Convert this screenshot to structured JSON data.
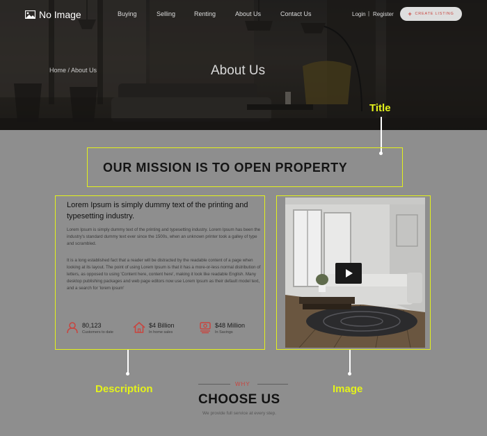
{
  "header": {
    "logo_text": "No Image",
    "nav": [
      "Buying",
      "Selling",
      "Renting",
      "About Us",
      "Contact Us"
    ],
    "login": "Login",
    "separator": "|",
    "register": "Register",
    "create_listing": "CREATE LISTING"
  },
  "hero": {
    "breadcrumb": "Home / About Us",
    "title": "About Us"
  },
  "annotations": {
    "title": "Title",
    "description": "Description",
    "image": "Image"
  },
  "mission": {
    "heading": "OUR MISSION IS TO OPEN PROPERTY",
    "lead": "Lorem Ipsum is simply dummy text of the printing and typesetting industry.",
    "paragraph1": "Lorem Ipsum is simply dummy text of the printing and typesetting industry. Lorem Ipsum has been the industry's standard dummy text ever since the 1500s, when an unknown printer took a galley of type and scrambled.",
    "paragraph2": "It is a long established fact that a reader will be distracted by the readable content of a page when looking at its layout. The point of using Lorem Ipsum is that it has a more-or-less normal distribution of letters, as opposed to using 'Content here, content here', making it look like readable English. Many desktop publishing packages and web page editors now use Lorem Ipsum as their default model text, and a search for 'lorem ipsum'",
    "stats": [
      {
        "icon": "user-icon",
        "value": "80,123",
        "caption": "Customers to date"
      },
      {
        "icon": "home-icon",
        "value": "$4 Billion",
        "caption": "In home sales"
      },
      {
        "icon": "savings-icon",
        "value": "$48 Million",
        "caption": "In Savings"
      }
    ]
  },
  "why": {
    "eyebrow": "WHY",
    "heading": "CHOOSE US",
    "subtitle": "We provide full service at every step."
  },
  "colors": {
    "annotation": "#e4f21b",
    "accent": "#c8453f",
    "page_background": "#8e8e8e"
  }
}
